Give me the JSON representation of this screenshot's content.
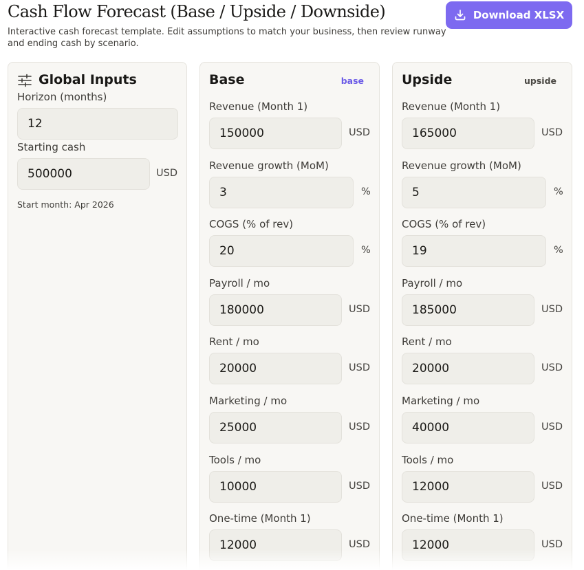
{
  "header": {
    "title": "Cash Flow Forecast (Base / Upside / Downside)",
    "subtitle": "Interactive cash forecast template. Edit assumptions to match your business, then review runway and ending cash by scenario.",
    "download_label": "Download XLSX",
    "download_icon": "download-icon"
  },
  "global_inputs": {
    "title": "Global Inputs",
    "icon": "sliders-icon",
    "horizon_label": "Horizon (months)",
    "horizon_value": "12",
    "starting_cash_label": "Starting cash",
    "starting_cash_value": "500000",
    "starting_cash_unit": "USD",
    "start_month_note": "Start month: Apr 2026"
  },
  "scenarios": [
    {
      "title": "Base",
      "tag": "base",
      "tag_color": "#6c5ce7",
      "fields": [
        {
          "label": "Revenue (Month 1)",
          "value": "150000",
          "unit": "USD"
        },
        {
          "label": "Revenue growth (MoM)",
          "value": "3",
          "unit": "%"
        },
        {
          "label": "COGS (% of rev)",
          "value": "20",
          "unit": "%"
        },
        {
          "label": "Payroll / mo",
          "value": "180000",
          "unit": "USD"
        },
        {
          "label": "Rent / mo",
          "value": "20000",
          "unit": "USD"
        },
        {
          "label": "Marketing / mo",
          "value": "25000",
          "unit": "USD"
        },
        {
          "label": "Tools / mo",
          "value": "10000",
          "unit": "USD"
        },
        {
          "label": "One-time (Month 1)",
          "value": "12000",
          "unit": "USD"
        }
      ]
    },
    {
      "title": "Upside",
      "tag": "upside",
      "tag_color": "#4a4843",
      "fields": [
        {
          "label": "Revenue (Month 1)",
          "value": "165000",
          "unit": "USD"
        },
        {
          "label": "Revenue growth (MoM)",
          "value": "5",
          "unit": "%"
        },
        {
          "label": "COGS (% of rev)",
          "value": "19",
          "unit": "%"
        },
        {
          "label": "Payroll / mo",
          "value": "185000",
          "unit": "USD"
        },
        {
          "label": "Rent / mo",
          "value": "20000",
          "unit": "USD"
        },
        {
          "label": "Marketing / mo",
          "value": "40000",
          "unit": "USD"
        },
        {
          "label": "Tools / mo",
          "value": "12000",
          "unit": "USD"
        },
        {
          "label": "One-time (Month 1)",
          "value": "12000",
          "unit": "USD"
        }
      ]
    }
  ],
  "colors": {
    "accent": "#7d6af0",
    "panel_bg": "#f8f7f4",
    "input_bg": "#efeee9"
  }
}
